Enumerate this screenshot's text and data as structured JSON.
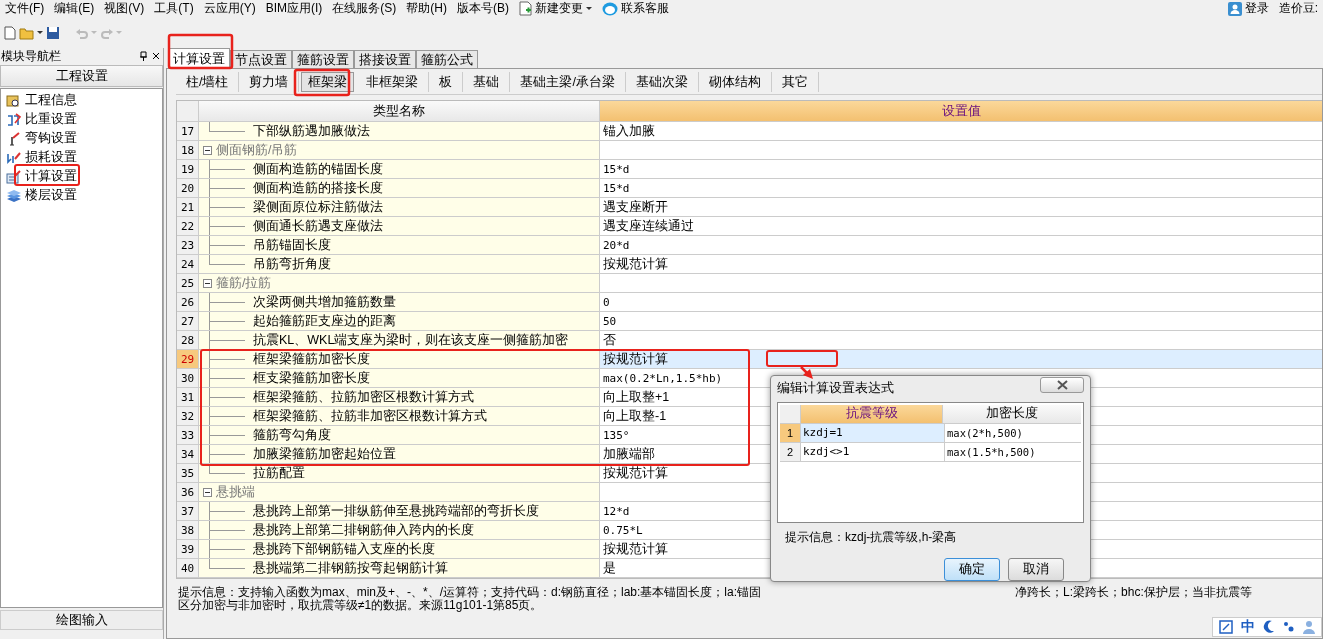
{
  "menu": [
    "文件(F)",
    "编辑(E)",
    "视图(V)",
    "工具(T)",
    "云应用(Y)",
    "BIM应用(I)",
    "在线服务(S)",
    "帮助(H)",
    "版本号(B)"
  ],
  "menu_extra": {
    "change": "新建变更",
    "service": "联系客服",
    "login": "登录",
    "beans": "造价豆:"
  },
  "sidebar": {
    "title": "模块导航栏",
    "section": "工程设置",
    "items": [
      {
        "label": "工程信息",
        "kind": "info"
      },
      {
        "label": "比重设置",
        "kind": "weight"
      },
      {
        "label": "弯钩设置",
        "kind": "hook"
      },
      {
        "label": "损耗设置",
        "kind": "loss"
      },
      {
        "label": "计算设置",
        "kind": "calc"
      },
      {
        "label": "楼层设置",
        "kind": "floor"
      }
    ],
    "bottom": "绘图输入"
  },
  "tabs": [
    {
      "label": "计算设置",
      "selected": true
    },
    {
      "label": "节点设置",
      "selected": false
    },
    {
      "label": "箍筋设置",
      "selected": false
    },
    {
      "label": "搭接设置",
      "selected": false
    },
    {
      "label": "箍筋公式",
      "selected": false
    }
  ],
  "subtabs": [
    {
      "label": "柱/墙柱",
      "selected": false
    },
    {
      "label": "剪力墙",
      "selected": false
    },
    {
      "label": "框架梁",
      "selected": true
    },
    {
      "label": "非框架梁",
      "selected": false
    },
    {
      "label": "板",
      "selected": false
    },
    {
      "label": "基础",
      "selected": false
    },
    {
      "label": "基础主梁/承台梁",
      "selected": false
    },
    {
      "label": "基础次梁",
      "selected": false
    },
    {
      "label": "砌体结构",
      "selected": false
    },
    {
      "label": "其它",
      "selected": false
    }
  ],
  "table": {
    "columns": [
      {
        "label": "类型名称",
        "selected": false
      },
      {
        "label": "设置值",
        "selected": true
      }
    ],
    "rows": [
      {
        "no": "17",
        "kind": "item",
        "name": "下部纵筋遇加腋做法",
        "value": "锚入加腋",
        "last": true,
        "selected": false
      },
      {
        "no": "18",
        "kind": "group",
        "name": "侧面钢筋/吊筋",
        "expanded": true,
        "selected": false
      },
      {
        "no": "19",
        "kind": "item",
        "name": "侧面构造筋的锚固长度",
        "value": "15*d",
        "last": false,
        "selected": false
      },
      {
        "no": "20",
        "kind": "item",
        "name": "侧面构造筋的搭接长度",
        "value": "15*d",
        "last": false,
        "selected": false
      },
      {
        "no": "21",
        "kind": "item",
        "name": "梁侧面原位标注筋做法",
        "value": "遇支座断开",
        "last": false,
        "selected": false
      },
      {
        "no": "22",
        "kind": "item",
        "name": "侧面通长筋遇支座做法",
        "value": "遇支座连续通过",
        "last": false,
        "selected": false
      },
      {
        "no": "23",
        "kind": "item",
        "name": "吊筋锚固长度",
        "value": "20*d",
        "last": false,
        "selected": false
      },
      {
        "no": "24",
        "kind": "item",
        "name": "吊筋弯折角度",
        "value": "按规范计算",
        "last": true,
        "selected": false
      },
      {
        "no": "25",
        "kind": "group",
        "name": "箍筋/拉筋",
        "expanded": true,
        "selected": false
      },
      {
        "no": "26",
        "kind": "item",
        "name": "次梁两侧共增加箍筋数量",
        "value": "0",
        "last": false,
        "selected": false
      },
      {
        "no": "27",
        "kind": "item",
        "name": "起始箍筋距支座边的距离",
        "value": "50",
        "last": false,
        "selected": false
      },
      {
        "no": "28",
        "kind": "item",
        "name": "抗震KL、WKL端支座为梁时，则在该支座一侧箍筋加密",
        "value": "否",
        "last": false,
        "selected": false
      },
      {
        "no": "29",
        "kind": "item",
        "name": "框架梁箍筋加密长度",
        "value": "按规范计算",
        "last": false,
        "selected": true
      },
      {
        "no": "30",
        "kind": "item",
        "name": "框支梁箍筋加密长度",
        "value": "max(0.2*Ln,1.5*hb)",
        "last": false,
        "selected": false
      },
      {
        "no": "31",
        "kind": "item",
        "name": "框架梁箍筋、拉筋加密区根数计算方式",
        "value": "向上取整+1",
        "last": false,
        "selected": false
      },
      {
        "no": "32",
        "kind": "item",
        "name": "框架梁箍筋、拉筋非加密区根数计算方式",
        "value": "向上取整-1",
        "last": false,
        "selected": false
      },
      {
        "no": "33",
        "kind": "item",
        "name": "箍筋弯勾角度",
        "value": "135°",
        "last": false,
        "selected": false
      },
      {
        "no": "34",
        "kind": "item",
        "name": "加腋梁箍筋加密起始位置",
        "value": "加腋端部",
        "last": false,
        "selected": false
      },
      {
        "no": "35",
        "kind": "item",
        "name": "拉筋配置",
        "value": "按规范计算",
        "last": true,
        "selected": false
      },
      {
        "no": "36",
        "kind": "group",
        "name": "悬挑端",
        "expanded": true,
        "selected": false
      },
      {
        "no": "37",
        "kind": "item",
        "name": "悬挑跨上部第一排纵筋伸至悬挑跨端部的弯折长度",
        "value": "12*d",
        "last": false,
        "selected": false
      },
      {
        "no": "38",
        "kind": "item",
        "name": "悬挑跨上部第二排钢筋伸入跨内的长度",
        "value": "0.75*L",
        "last": false,
        "selected": false
      },
      {
        "no": "39",
        "kind": "item",
        "name": "悬挑跨下部钢筋锚入支座的长度",
        "value": "按规范计算",
        "last": false,
        "selected": false
      },
      {
        "no": "40",
        "kind": "item",
        "name": "悬挑端第二排钢筋按弯起钢筋计算",
        "value": "是",
        "last": true,
        "selected": false
      }
    ]
  },
  "hint": {
    "line1_start": "提示信息：支持输入函数为max、min及+、-、*、/运算符；支持代码：d:钢筋直径；lab:基本锚固长度；la:锚固",
    "line1_end": "净跨长；L:梁跨长；bhc:保护层；当非抗震等",
    "line2": "区分加密与非加密时，取抗震等级≠1的数据。来源11g101-1第85页。"
  },
  "dialog": {
    "title": "编辑计算设置表达式",
    "columns": [
      {
        "label": "抗震等级",
        "selected": true
      },
      {
        "label": "加密长度",
        "selected": false
      }
    ],
    "rows": [
      {
        "no": "1",
        "grade": "kzdj=1",
        "length": "max(2*h,500)",
        "selected": true
      },
      {
        "no": "2",
        "grade": "kzdj<>1",
        "length": "max(1.5*h,500)",
        "selected": false
      }
    ],
    "hint": "提示信息：kzdj-抗震等级,h-梁高",
    "buttons": [
      {
        "label": "确定",
        "kind": "default"
      },
      {
        "label": "取消",
        "kind": "normal"
      }
    ]
  },
  "ime": {
    "mode": "中"
  }
}
